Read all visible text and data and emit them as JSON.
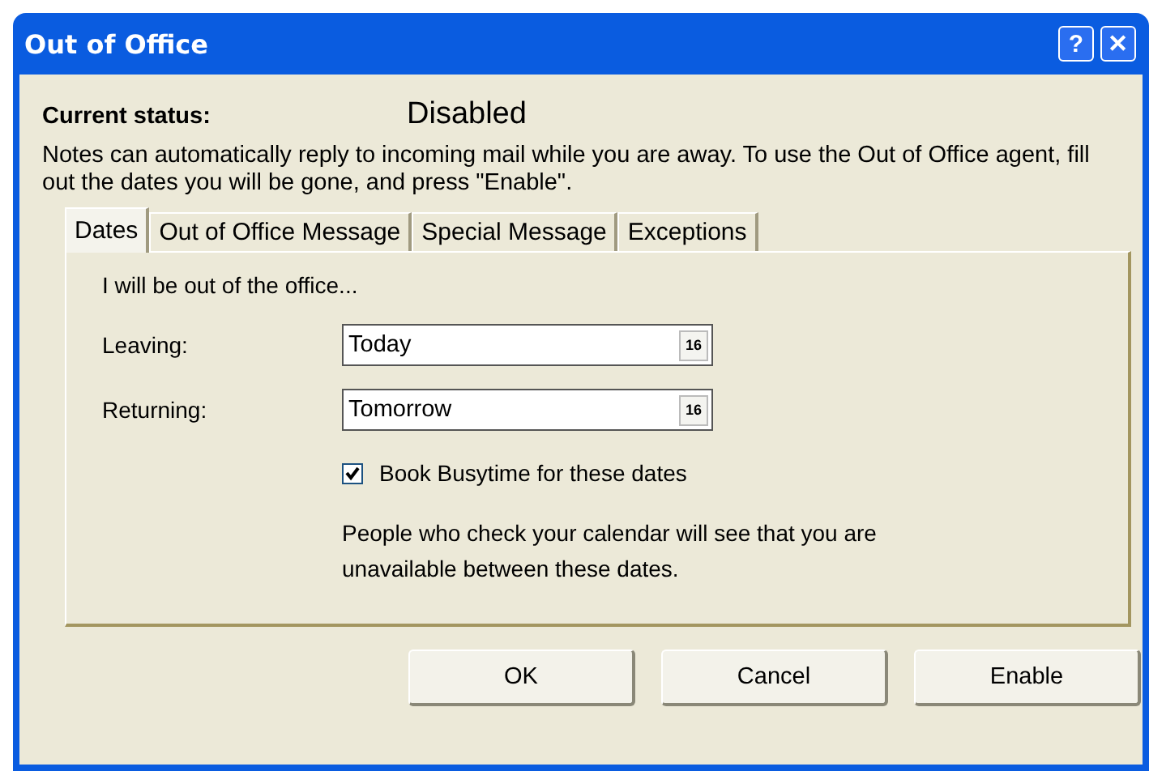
{
  "window": {
    "title": "Out of Office",
    "help_button": "?",
    "close_button": "✕"
  },
  "status": {
    "label": "Current status:",
    "value": "Disabled"
  },
  "intro": "Notes can automatically reply to incoming mail while you are away. To use the Out of Office agent, fill out the dates you will be gone, and press \"Enable\".",
  "tabs": [
    {
      "label": "Dates",
      "selected": true
    },
    {
      "label": "Out of Office Message",
      "selected": false
    },
    {
      "label": "Special Message",
      "selected": false
    },
    {
      "label": "Exceptions",
      "selected": false
    }
  ],
  "panel": {
    "heading": "I will be out of the office...",
    "fields": [
      {
        "label": "Leaving:",
        "value": "Today",
        "calendar": "16"
      },
      {
        "label": "Returning:",
        "value": "Tomorrow",
        "calendar": "16"
      }
    ],
    "checkbox": {
      "label": "Book Busytime for these dates",
      "checked": true
    },
    "note": "People who check your calendar will see that you are unavailable between these dates."
  },
  "buttons": [
    "OK",
    "Cancel",
    "Enable"
  ]
}
